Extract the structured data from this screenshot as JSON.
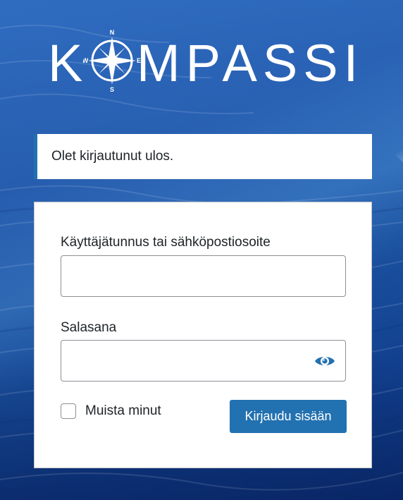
{
  "logo": {
    "text_left": "K",
    "text_right": "MPASSI",
    "compass_labels": {
      "north": "N",
      "south": "S",
      "east": "E",
      "west": "W"
    }
  },
  "message": {
    "text": "Olet kirjautunut ulos."
  },
  "form": {
    "username_label": "Käyttäjätunnus tai sähköpostiosoite",
    "username_value": "",
    "password_label": "Salasana",
    "password_value": "",
    "remember_label": "Muista minut",
    "remember_checked": false,
    "submit_label": "Kirjaudu sisään"
  },
  "icons": {
    "password_toggle": "eye-icon",
    "logo_compass": "compass-rose-icon"
  },
  "colors": {
    "accent": "#2271b1",
    "message_border": "#2271b1",
    "text": "#1d2327",
    "input_border": "#8c8f94"
  }
}
